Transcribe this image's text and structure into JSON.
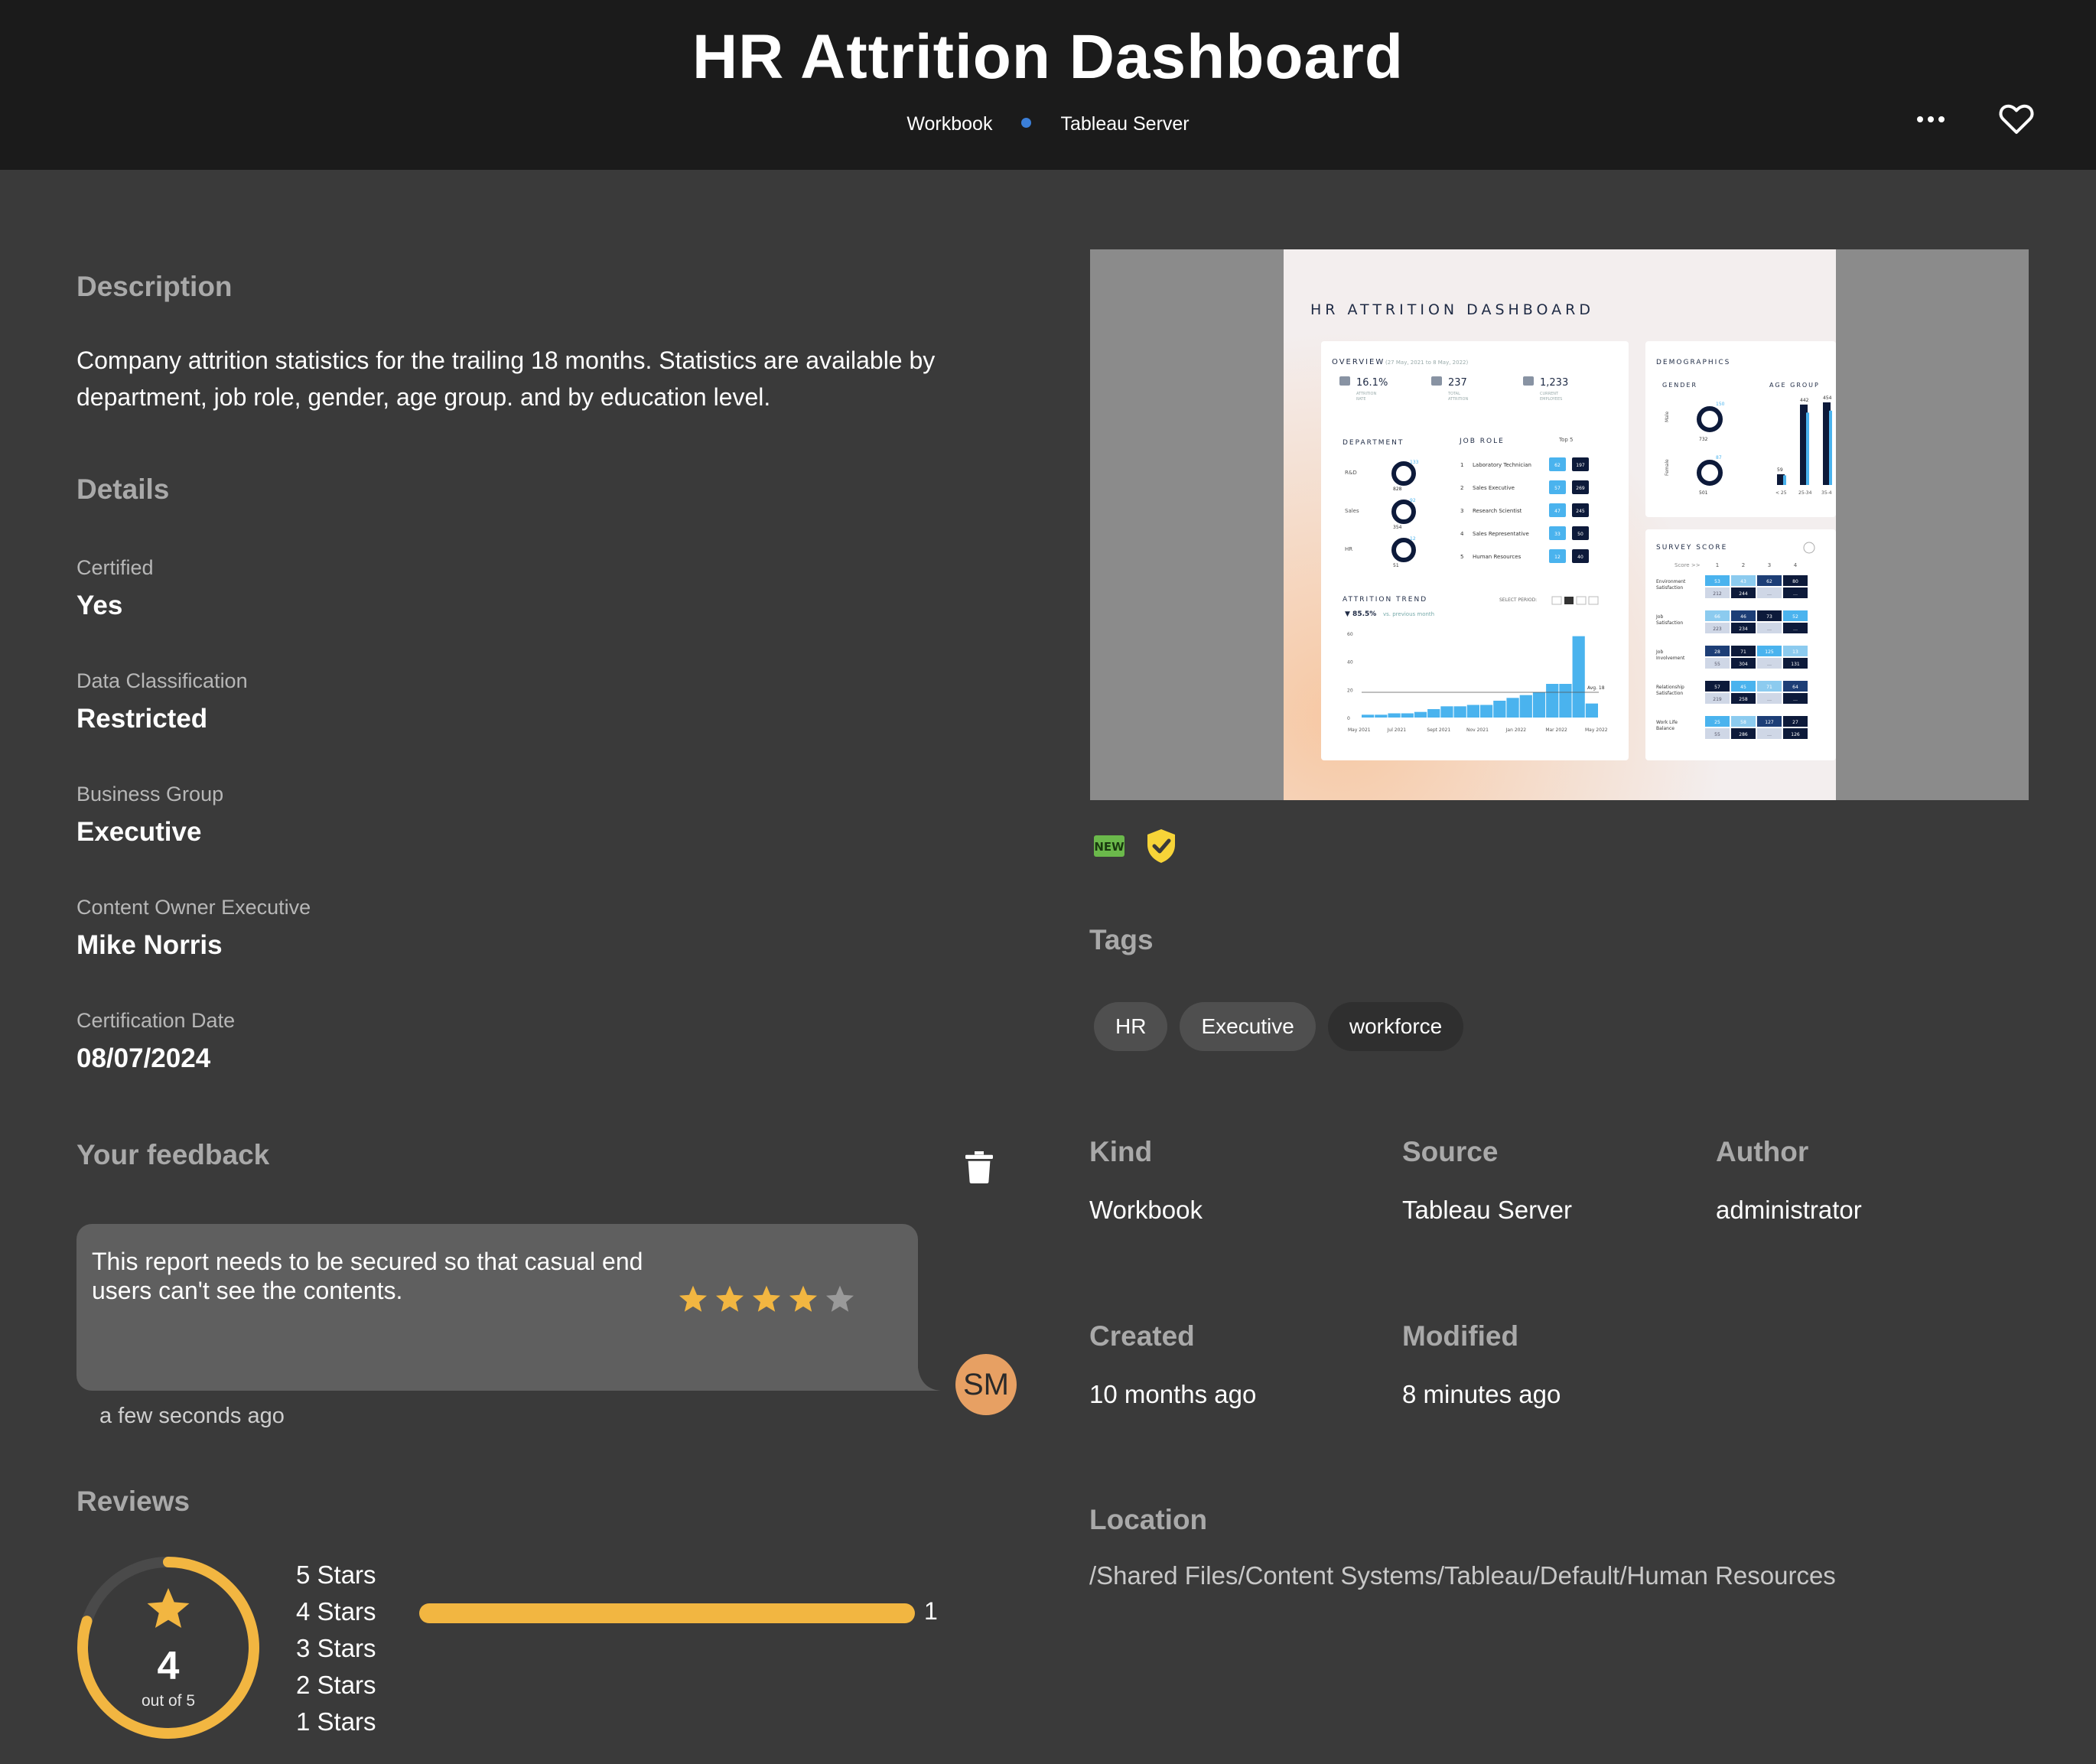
{
  "header": {
    "title": "HR Attrition Dashboard",
    "kind": "Workbook",
    "source": "Tableau Server"
  },
  "description": {
    "heading": "Description",
    "text_line1": "Company attrition statistics for the trailing 18 months. Statistics are available by",
    "text_line2": "department, job role, gender, age group. and by education level."
  },
  "details": {
    "heading": "Details",
    "items": [
      {
        "label": "Certified",
        "value": "Yes"
      },
      {
        "label": "Data Classification",
        "value": "Restricted"
      },
      {
        "label": "Business Group",
        "value": "Executive"
      },
      {
        "label": "Content Owner Executive",
        "value": "Mike Norris"
      },
      {
        "label": "Certification Date",
        "value": "08/07/2024"
      }
    ]
  },
  "feedback": {
    "heading": "Your feedback",
    "line1": "This report needs to be secured so that casual end",
    "line2": "users can't see the contents.",
    "stars": 4,
    "stars_max": 5,
    "avatar_initials": "SM",
    "time": "a few seconds ago"
  },
  "reviews": {
    "heading": "Reviews",
    "average": "4",
    "out_of": "out of 5",
    "rating_fraction": 0.8,
    "breakdown": [
      {
        "label": "5 Stars",
        "count": "",
        "fraction": 0
      },
      {
        "label": "4 Stars",
        "count": "1",
        "fraction": 1
      },
      {
        "label": "3 Stars",
        "count": "",
        "fraction": 0
      },
      {
        "label": "2 Stars",
        "count": "",
        "fraction": 0
      },
      {
        "label": "1 Stars",
        "count": "",
        "fraction": 0
      }
    ]
  },
  "badges": {
    "new": "NEW",
    "new_icon": "new-badge-icon",
    "certified_icon": "certified-shield-icon"
  },
  "tags": {
    "heading": "Tags",
    "items": [
      "HR",
      "Executive",
      "workforce"
    ]
  },
  "meta": {
    "kind_label": "Kind",
    "kind_value": "Workbook",
    "source_label": "Source",
    "source_value": "Tableau Server",
    "author_label": "Author",
    "author_value": "administrator",
    "created_label": "Created",
    "created_value": "10 months ago",
    "modified_label": "Modified",
    "modified_value": "8 minutes ago",
    "location_label": "Location",
    "location_value": "/Shared Files/Content Systems/Tableau/Default/Human Resources"
  },
  "thumbnail": {
    "title": "HR ATTRITION DASHBOARD",
    "overview": "OVERVIEW",
    "overview_range": "(27 May, 2021 to 8 May, 2022)",
    "kpis": [
      {
        "value": "16.1%",
        "label1": "ATTRITION",
        "label2": "RATE"
      },
      {
        "value": "237",
        "label1": "TOTAL",
        "label2": "ATTRITION"
      },
      {
        "value": "1,233",
        "label1": "CURRENT",
        "label2": "EMPLOYEES"
      }
    ],
    "department": "DEPARTMENT",
    "departments": [
      {
        "name": "R&D",
        "a": "133",
        "b": "828"
      },
      {
        "name": "Sales",
        "a": "92",
        "b": "354"
      },
      {
        "name": "HR",
        "a": "12",
        "b": "51"
      }
    ],
    "job_role": "JOB ROLE",
    "top5": "Top 5",
    "roles": [
      {
        "rank": "1",
        "name": "Laboratory Technician",
        "a": "62",
        "b": "197"
      },
      {
        "rank": "2",
        "name": "Sales Executive",
        "a": "57",
        "b": "269"
      },
      {
        "rank": "3",
        "name": "Research Scientist",
        "a": "47",
        "b": "245"
      },
      {
        "rank": "4",
        "name": "Sales Representative",
        "a": "33",
        "b": "50"
      },
      {
        "rank": "5",
        "name": "Human Resources",
        "a": "12",
        "b": "40"
      }
    ],
    "trend": "ATTRITION TREND",
    "select_period": "SELECT PERIOD:",
    "trend_change": "▼ 85.5%",
    "trend_change_note": "vs. previous month",
    "trend_y_ticks": [
      "60",
      "40",
      "20",
      "0"
    ],
    "trend_x_ticks": [
      "May 2021",
      "Jul 2021",
      "Sept 2021",
      "Nov 2021",
      "Jan 2022",
      "Mar 2022",
      "May 2022"
    ],
    "trend_avg": "Avg. 18",
    "trend_values": [
      2,
      2,
      3,
      3,
      4,
      6,
      8,
      8,
      9,
      9,
      12,
      14,
      16,
      18,
      24,
      24,
      58,
      10
    ],
    "demographics": "DEMOGRAPHICS",
    "gender": "GENDER",
    "genders": [
      {
        "name": "Male",
        "a": "150",
        "b": "732"
      },
      {
        "name": "Female",
        "a": "87",
        "b": "501"
      }
    ],
    "age_group": "AGE GROUP",
    "age_labels": [
      "< 25",
      "25-34",
      "35-4"
    ],
    "age_values": [
      59,
      442,
      454
    ],
    "survey": "SURVEY SCORE",
    "survey_scale": "Score >>",
    "survey_cols": [
      "1",
      "2",
      "3",
      "4"
    ],
    "survey_rows": [
      {
        "name1": "Environment",
        "name2": "Satisfaction",
        "top": [
          "53",
          "43",
          "62",
          "80"
        ],
        "bottom": [
          "212",
          "244",
          "…",
          "…"
        ]
      },
      {
        "name1": "Job",
        "name2": "Satisfaction",
        "top": [
          "66",
          "46",
          "73",
          "52"
        ],
        "bottom": [
          "223",
          "234",
          "…",
          "…"
        ]
      },
      {
        "name1": "Job",
        "name2": "Involvement",
        "top": [
          "28",
          "71",
          "125",
          "13"
        ],
        "bottom": [
          "55",
          "304",
          "…",
          "131"
        ]
      },
      {
        "name1": "Relationship",
        "name2": "Satisfaction",
        "top": [
          "57",
          "45",
          "71",
          "64"
        ],
        "bottom": [
          "219",
          "258",
          "…",
          "…"
        ]
      },
      {
        "name1": "Work Life",
        "name2": "Balance",
        "top": [
          "25",
          "58",
          "127",
          "27"
        ],
        "bottom": [
          "55",
          "286",
          "…",
          "126"
        ]
      }
    ]
  },
  "colors": {
    "accent_star": "#f2b641",
    "avatar": "#e7a063",
    "dot": "#3b7fd8",
    "chart_blue": "#4ab3ee",
    "chart_navy": "#0d1a3a"
  }
}
